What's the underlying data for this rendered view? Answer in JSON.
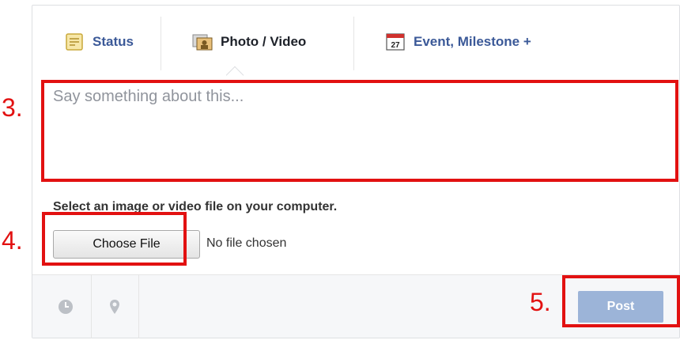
{
  "tabs": [
    {
      "label": "Status",
      "icon": "status-icon"
    },
    {
      "label": "Photo / Video",
      "icon": "photo-icon"
    },
    {
      "label": "Event, Milestone +",
      "icon": "calendar-icon",
      "calendar_day": "27"
    }
  ],
  "composer": {
    "placeholder": "Say something about this...",
    "file_prompt": "Select an image or video file on your computer.",
    "choose_file_label": "Choose File",
    "no_file_text": "No file chosen",
    "post_label": "Post"
  },
  "annotations": [
    "3.",
    "4.",
    "5."
  ],
  "colors": {
    "link": "#3b5998",
    "post_button": "#9cb4d8",
    "annotation": "#e21111",
    "bottom_bar": "#f6f7f9"
  }
}
